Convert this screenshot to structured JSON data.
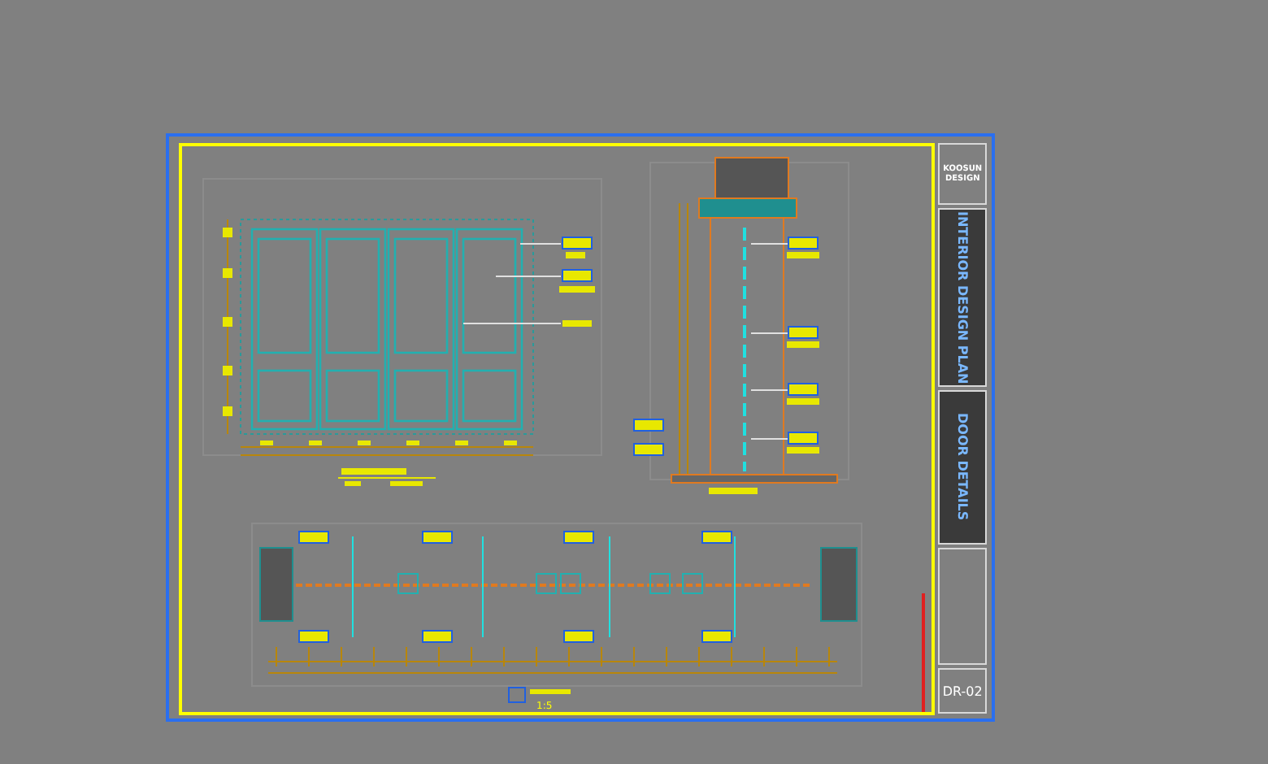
{
  "title_block": {
    "firm_name": "KOOSUN",
    "firm_subtitle": "DESIGN",
    "project_title": "INTERIOR DESIGN PLAN",
    "drawing_title": "DOOR DETAILS",
    "sheet_number": "DR-02"
  },
  "plan_view": {
    "scale": "1:5"
  }
}
